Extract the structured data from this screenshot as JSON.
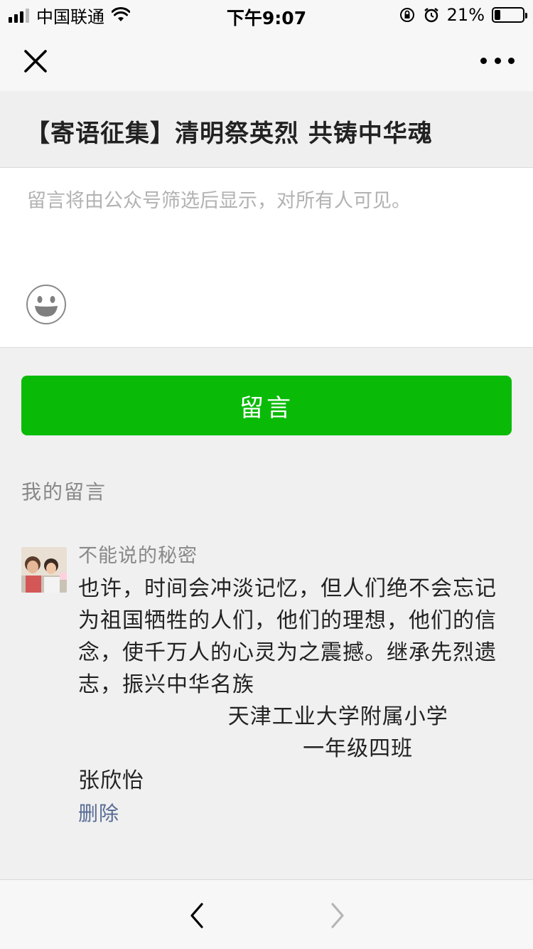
{
  "status_bar": {
    "carrier": "中国联通",
    "time": "下午9:07",
    "battery_percent": "21%",
    "battery_level": 0.21
  },
  "nav": {
    "close_icon": "close-icon",
    "more_icon": "more-dots-icon"
  },
  "article": {
    "title": "【寄语征集】清明祭英烈 共铸中华魂"
  },
  "comment_form": {
    "placeholder": "留言将由公众号筛选后显示，对所有人可见。",
    "emoji_icon": "smiley-emoji-icon",
    "submit_label": "留言",
    "submit_color": "#09bb07"
  },
  "my_comments": {
    "section_title": "我的留言",
    "items": [
      {
        "nickname": "不能说的秘密",
        "content": "也许，时间会冲淡记忆，但人们绝不会忘记为祖国牺牲的人们，他们的理想，他们的信念，使千万人的心灵为之震撼。继承先烈遗志，振兴中华名族\n                    天津工业大学附属小学\n                              一年级四班\n张欣怡",
        "delete_label": "删除",
        "link_color": "#576b95"
      }
    ]
  },
  "toolbar": {
    "back_icon": "chevron-left-icon",
    "forward_icon": "chevron-right-icon"
  }
}
